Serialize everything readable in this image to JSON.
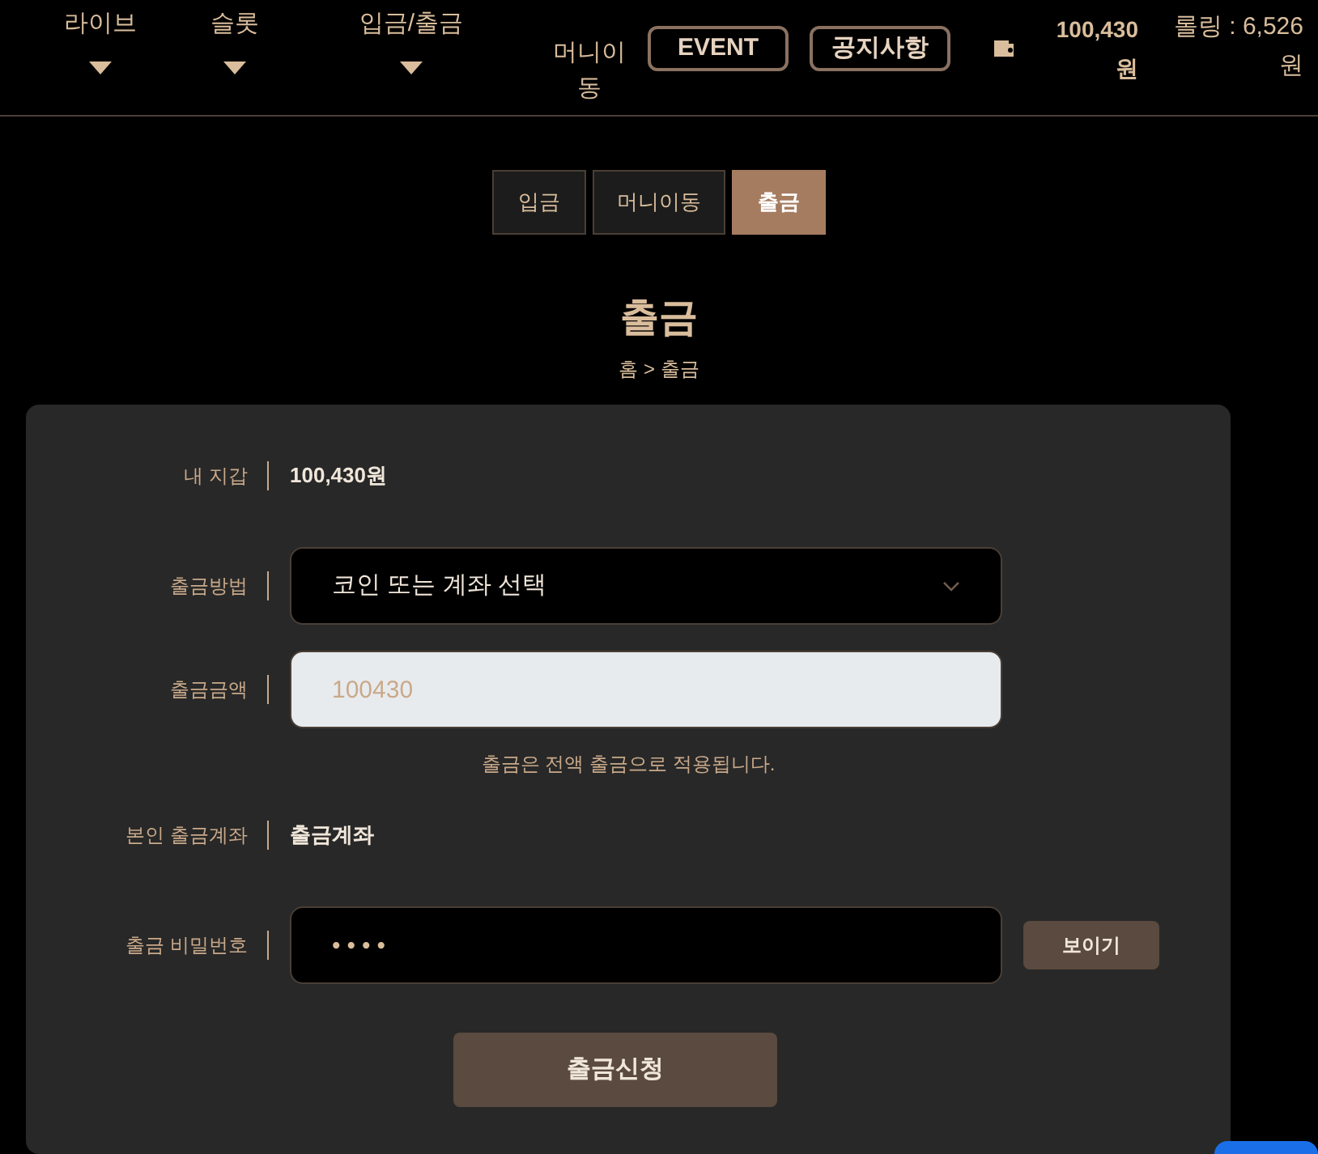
{
  "nav": {
    "items": [
      {
        "label": "라이브",
        "dropdown": true
      },
      {
        "label": "슬롯",
        "dropdown": true
      },
      {
        "label": "입금/출금",
        "dropdown": true
      },
      {
        "label": "머니이동",
        "dropdown": false
      }
    ],
    "buttons": [
      "EVENT",
      "공지사항"
    ],
    "balance": {
      "amount": "100,430",
      "unit": "원"
    },
    "rolling": {
      "amount": "롤링 : 6,526",
      "unit": "원"
    }
  },
  "tabs": [
    {
      "label": "입금",
      "selected": false
    },
    {
      "label": "머니이동",
      "selected": false
    },
    {
      "label": "출금",
      "selected": true
    }
  ],
  "title": "출금",
  "breadcrumb": "홈 > 출금",
  "form": {
    "rows": [
      {
        "kind": "text",
        "label": "내 지갑",
        "value": "100,430원"
      },
      {
        "kind": "select",
        "label": "출금방법",
        "value": "코인 또는 계좌 선택"
      },
      {
        "kind": "input",
        "label": "출금금액",
        "value": "100430",
        "readonly": true
      },
      {
        "kind": "note",
        "text": "출금은 전액 출금으로 적용됩니다."
      },
      {
        "kind": "text",
        "label": "본인 출금계좌",
        "value": "출금계좌"
      },
      {
        "kind": "password",
        "label": "출금 비밀번호",
        "value": "••••",
        "button": "보이기"
      }
    ],
    "submit": "출금신청"
  }
}
